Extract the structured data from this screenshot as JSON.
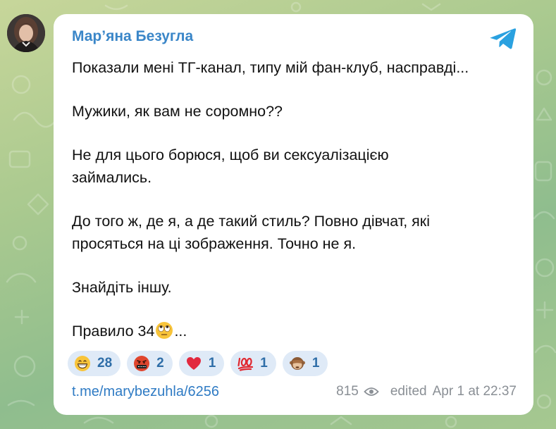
{
  "colors": {
    "accent": "#3a86c8",
    "link": "#2f7bc4",
    "reaction_bg": "#dfeaf7",
    "reaction_text": "#2f6ea8",
    "meta_text": "#8a8f95",
    "telegram": "#2aa1e0"
  },
  "post": {
    "author": "Мар’яна Безугла",
    "channel_icon": "telegram-icon",
    "paragraphs": [
      {
        "lines": [
          "Показали мені ТГ-канал, типу мій фан-клуб, насправді..."
        ]
      },
      {
        "lines": [
          "Мужики, як вам не соромно??"
        ]
      },
      {
        "lines": [
          "Не для цього борюся, щоб ви сексуалізацією",
          "займались."
        ]
      },
      {
        "lines": [
          "До того ж, де я, а де такий стиль? Повно дівчат, які",
          "просяться на ці зображення. Точно не я."
        ]
      },
      {
        "lines": [
          "Знайдіть іншу."
        ]
      },
      {
        "before_emoji": "Правило 34",
        "emoji": "face-with-rolling-eyes",
        "after_emoji": "..."
      }
    ],
    "reactions": [
      {
        "emoji": "grinning-face",
        "count": "28"
      },
      {
        "emoji": "face-with-symbols-on-mouth",
        "count": "2"
      },
      {
        "emoji": "red-heart",
        "count": "1"
      },
      {
        "emoji": "hundred-points",
        "count": "1"
      },
      {
        "emoji": "see-no-evil-monkey",
        "count": "1"
      }
    ],
    "link": "t.me/marybezuhla/6256",
    "views": "815",
    "views_icon": "eye-icon",
    "edited": "edited",
    "timestamp": "Apr 1 at 22:37"
  }
}
